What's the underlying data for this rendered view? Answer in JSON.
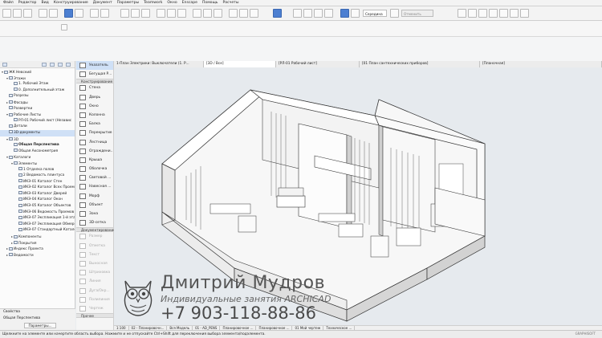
{
  "menu": [
    "Файл",
    "Редактор",
    "Вид",
    "Конструирование",
    "Документ",
    "Параметры",
    "Teamwork",
    "Окно",
    "Enscape",
    "Помощь",
    "Расчеты"
  ],
  "toolbar": {
    "layer_label": "Середина",
    "active_button": "Отменить"
  },
  "tabs": [
    {
      "label": "1-План Электрики: Выключатели (1. Р...",
      "active": false
    },
    {
      "label": "[3D / Все]",
      "active": true
    },
    {
      "label": "[РЛ-01 Рабочий лист]",
      "active": false
    },
    {
      "label": "[01 План сантехнических приборов]",
      "active": false
    },
    {
      "label": "[Планочная]",
      "active": false
    }
  ],
  "navigator": {
    "items": [
      {
        "label": "ЖК Невский",
        "indent": 0,
        "toggle": "▾",
        "sel": false,
        "bold": false
      },
      {
        "label": "Этажи",
        "indent": 1,
        "toggle": "▾",
        "sel": false,
        "bold": false
      },
      {
        "label": "1. Рабочий Этаж",
        "indent": 2,
        "toggle": "",
        "sel": false,
        "bold": false
      },
      {
        "label": "0. Дополнительный этаж",
        "indent": 2,
        "toggle": "",
        "sel": false,
        "bold": false
      },
      {
        "label": "Разрезы",
        "indent": 1,
        "toggle": "",
        "sel": false,
        "bold": false
      },
      {
        "label": "Фасады",
        "indent": 1,
        "toggle": "▸",
        "sel": false,
        "bold": false
      },
      {
        "label": "Развертки",
        "indent": 1,
        "toggle": "",
        "sel": false,
        "bold": false
      },
      {
        "label": "Рабочие Листы",
        "indent": 1,
        "toggle": "▾",
        "sel": false,
        "bold": false
      },
      {
        "label": "РЛ-01 Рабочий лист (Независ",
        "indent": 2,
        "toggle": "",
        "sel": false,
        "bold": false
      },
      {
        "label": "Детали",
        "indent": 1,
        "toggle": "",
        "sel": false,
        "bold": false
      },
      {
        "label": "3D-документы",
        "indent": 1,
        "toggle": "",
        "sel": true,
        "bold": false
      },
      {
        "label": "3D",
        "indent": 1,
        "toggle": "▾",
        "sel": false,
        "bold": false
      },
      {
        "label": "Общая Перспектива",
        "indent": 2,
        "toggle": "",
        "sel": false,
        "bold": true
      },
      {
        "label": "Общая Аксонометрия",
        "indent": 2,
        "toggle": "",
        "sel": false,
        "bold": false
      },
      {
        "label": "Каталоги",
        "indent": 1,
        "toggle": "▾",
        "sel": false,
        "bold": false
      },
      {
        "label": "Элементы",
        "indent": 2,
        "toggle": "▾",
        "sel": false,
        "bold": false
      },
      {
        "label": "1 Отделка полов",
        "indent": 3,
        "toggle": "",
        "sel": false,
        "bold": false
      },
      {
        "label": "2 Ведомость плинтуса",
        "indent": 3,
        "toggle": "",
        "sel": false,
        "bold": false
      },
      {
        "label": "ИКЭ-01 Каталог Стен",
        "indent": 3,
        "toggle": "",
        "sel": false,
        "bold": false
      },
      {
        "label": "ИКЭ-02 Каталог Всех Проемов",
        "indent": 3,
        "toggle": "",
        "sel": false,
        "bold": false
      },
      {
        "label": "ИКЭ-03 Каталог Дверей",
        "indent": 3,
        "toggle": "",
        "sel": false,
        "bold": false
      },
      {
        "label": "ИКЭ-04 Каталог Окон",
        "indent": 3,
        "toggle": "",
        "sel": false,
        "bold": false
      },
      {
        "label": "ИКЭ-05 Каталог Объектов",
        "indent": 3,
        "toggle": "",
        "sel": false,
        "bold": false
      },
      {
        "label": "ИКЭ-06 Ведомость Проемов",
        "indent": 3,
        "toggle": "",
        "sel": false,
        "bold": false
      },
      {
        "label": "ИКЭ-07 Экспликация 1-й этаж",
        "indent": 3,
        "toggle": "",
        "sel": false,
        "bold": false
      },
      {
        "label": "ИКЭ-07 Экспликация Обмеры",
        "indent": 3,
        "toggle": "",
        "sel": false,
        "bold": false
      },
      {
        "label": "ИКЭ-07 Стандартный Каталог",
        "indent": 3,
        "toggle": "",
        "sel": false,
        "bold": false
      },
      {
        "label": "Компоненты",
        "indent": 2,
        "toggle": "▸",
        "sel": false,
        "bold": false
      },
      {
        "label": "Покрытия",
        "indent": 2,
        "toggle": "▸",
        "sel": false,
        "bold": false
      },
      {
        "label": "Индекс Проекта",
        "indent": 1,
        "toggle": "▸",
        "sel": false,
        "bold": false
      },
      {
        "label": "Ведомости",
        "indent": 1,
        "toggle": "▸",
        "sel": false,
        "bold": false
      }
    ],
    "bottom": {
      "properties_label": "Свойства",
      "view_name": "Общая Перспектива",
      "params_button": "Параметры..."
    }
  },
  "toolbox": {
    "top": [
      {
        "label": "Указатель",
        "sel": true
      },
      {
        "label": "Бегущая Р...",
        "sel": false
      }
    ],
    "section_construct": "Конструирование",
    "construct": [
      "Стена",
      "Дверь",
      "Окно",
      "Колонна",
      "Балка",
      "Перекрытие",
      "Лестница",
      "Ограждени...",
      "Крыша",
      "Оболочка",
      "Световой ...",
      "Навесная ...",
      "Морф",
      "Объект",
      "Зона",
      "3D-сетка"
    ],
    "section_doc": "Документирование",
    "doc": [
      "Размер",
      "Отметка",
      "Текст",
      "Выносная",
      "Штриховка",
      "Линия",
      "Дуга/Окр...",
      "Полилиния",
      "Чертеж"
    ],
    "more_label": "Прочее"
  },
  "navbar": [
    "1:100",
    "02 - Планировочн...",
    "Вся Модель",
    "01 - AD_PENS",
    "Планировочное ...",
    "Планировочное ...",
    "01 Мой чертеж",
    "Техническое ..."
  ],
  "statusbar": {
    "hint": "Щелкните на элементе или начертите область выбора. Нажмите и не отпускайте Ctrl+Shift для переключения выбора элемента/подэлемента."
  },
  "watermark": {
    "name": "Дмитрий Мудров",
    "subtitle": "Индивидуальные занятия ARCHICAD",
    "phone": "+7 903-118-88-86"
  },
  "brand": "GRAPHISOFT"
}
